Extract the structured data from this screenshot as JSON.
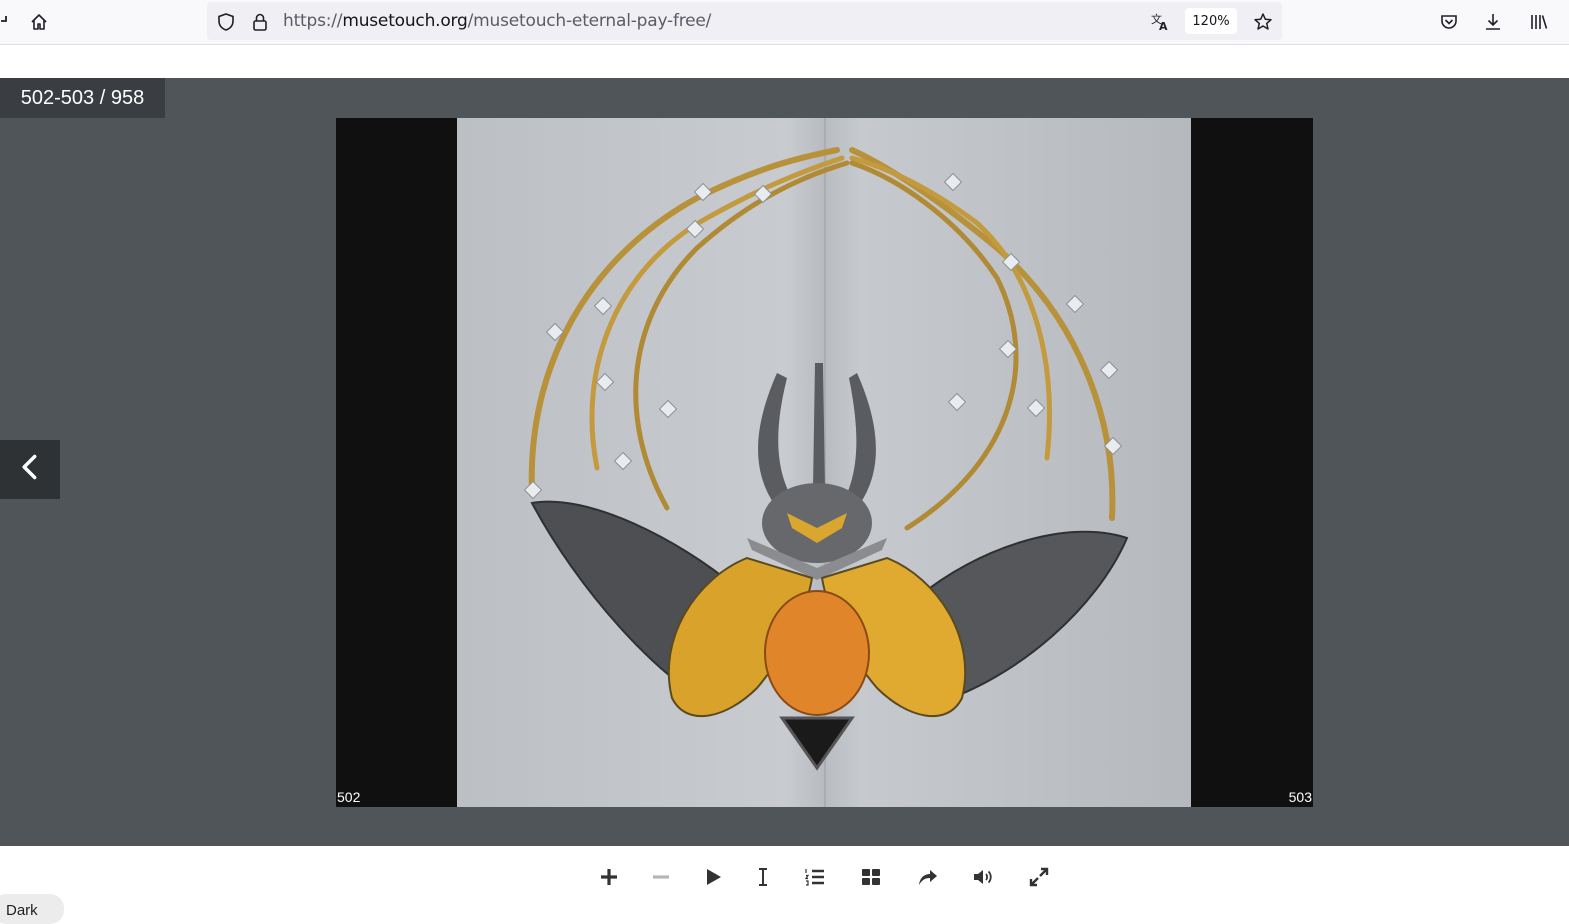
{
  "browser": {
    "url_prefix": "https://",
    "url_host": "musetouch.org",
    "url_path": "/musetouch-eternal-pay-free/",
    "zoom": "120%"
  },
  "viewer": {
    "page_counter": "502-503 / 958",
    "left_page_number": "502",
    "right_page_number": "503"
  },
  "theme_toggle": {
    "label": "Dark"
  },
  "colors": {
    "stage_background": "#50555a",
    "book_background": "#101010"
  }
}
